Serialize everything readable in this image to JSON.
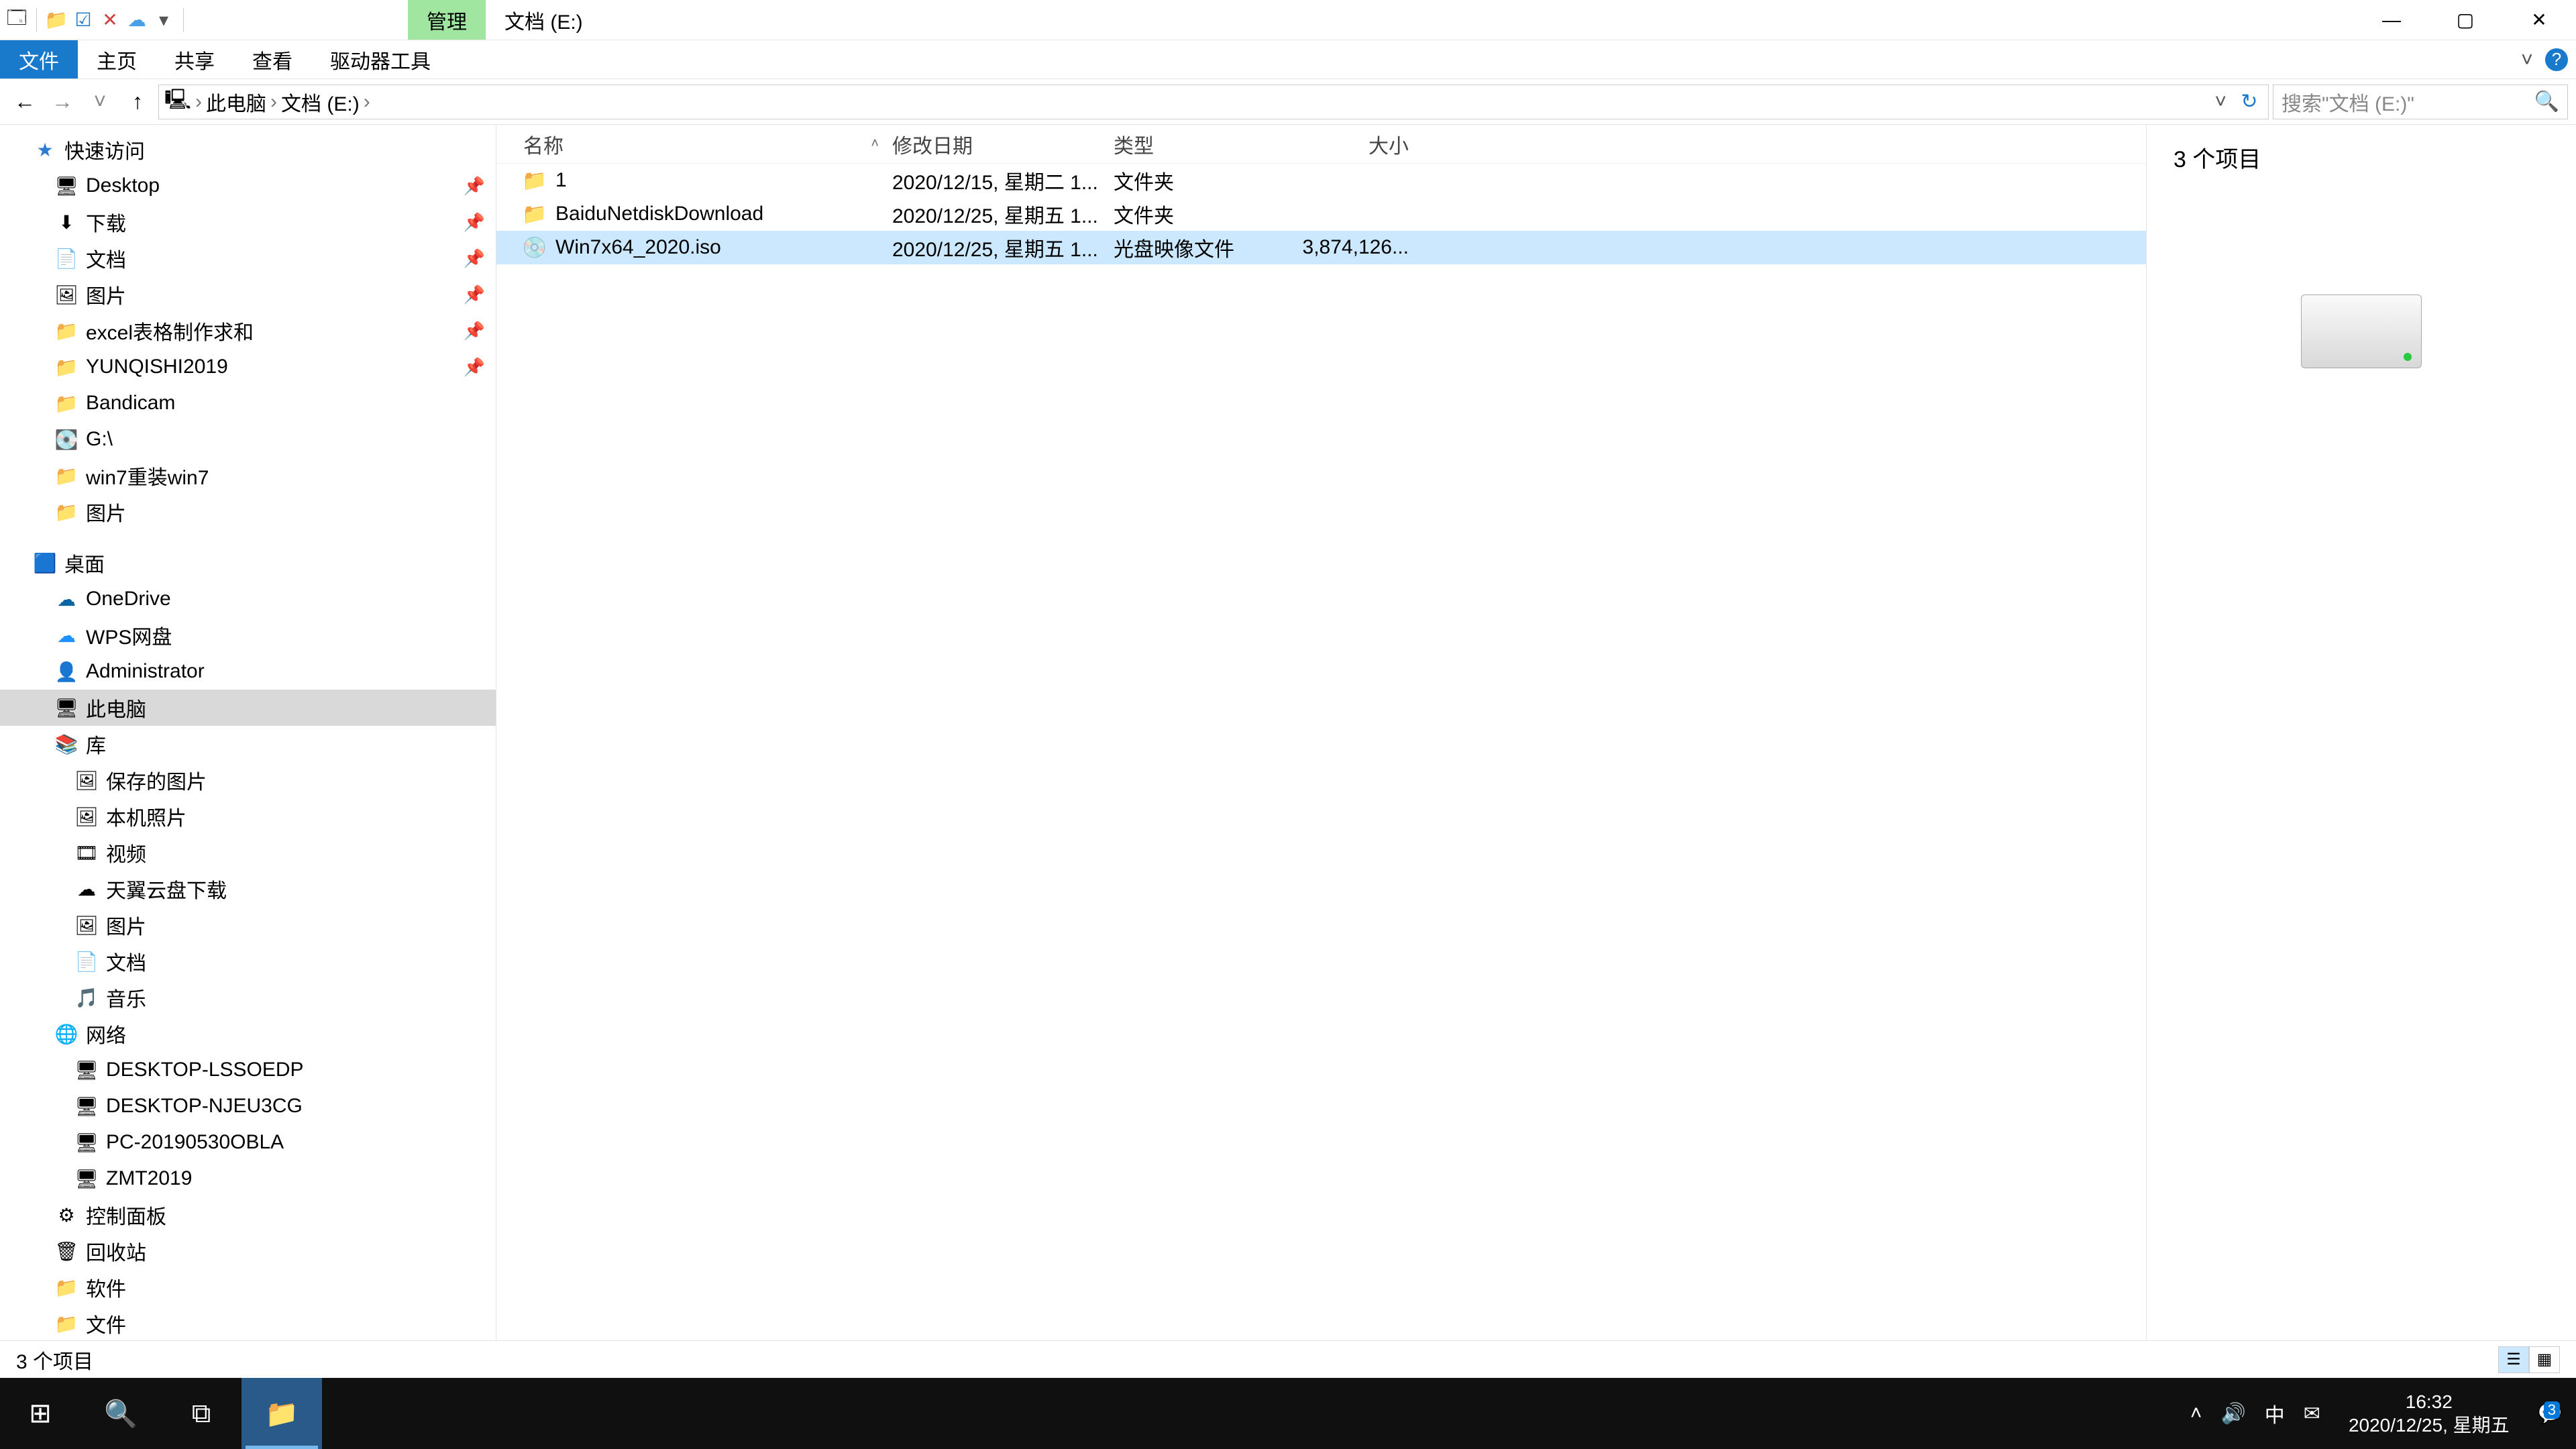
{
  "title": {
    "context_tab": "管理",
    "window_title": "文档 (E:)"
  },
  "window_controls": {
    "min": "—",
    "max": "▢",
    "close": "✕"
  },
  "ribbon": {
    "tabs": [
      "文件",
      "主页",
      "共享",
      "查看",
      "驱动器工具"
    ],
    "expand": "˅",
    "help": "?"
  },
  "nav": {
    "back": "←",
    "forward": "→",
    "recent": "˅",
    "up": "↑"
  },
  "breadcrumb": {
    "root_icon": "🖳",
    "items": [
      "此电脑",
      "文档 (E:)"
    ],
    "sep": "›"
  },
  "address_controls": {
    "dropdown": "˅",
    "refresh": "↻"
  },
  "search": {
    "placeholder": "搜索\"文档 (E:)\"",
    "icon": "🔍"
  },
  "tree": {
    "quick_access": {
      "label": "快速访问",
      "icon": "★"
    },
    "quick_items": [
      {
        "label": "Desktop",
        "icon": "🖥",
        "pinned": true
      },
      {
        "label": "下载",
        "icon": "⬇",
        "pinned": true
      },
      {
        "label": "文档",
        "icon": "📄",
        "pinned": true
      },
      {
        "label": "图片",
        "icon": "🖼",
        "pinned": true
      },
      {
        "label": "excel表格制作求和",
        "icon": "📁",
        "pinned": true
      },
      {
        "label": "YUNQISHI2019",
        "icon": "📁",
        "pinned": true
      },
      {
        "label": "Bandicam",
        "icon": "📁",
        "pinned": false
      },
      {
        "label": "G:\\",
        "icon": "💽",
        "pinned": false
      },
      {
        "label": "win7重装win7",
        "icon": "📁",
        "pinned": false
      },
      {
        "label": "图片",
        "icon": "📁",
        "pinned": false
      }
    ],
    "desktop": {
      "label": "桌面",
      "icon": "🟦"
    },
    "desktop_items": [
      {
        "label": "OneDrive",
        "icon": "☁"
      },
      {
        "label": "WPS网盘",
        "icon": "☁"
      },
      {
        "label": "Administrator",
        "icon": "👤"
      },
      {
        "label": "此电脑",
        "icon": "🖥",
        "selected": true
      },
      {
        "label": "库",
        "icon": "📚"
      }
    ],
    "lib_items": [
      {
        "label": "保存的图片",
        "icon": "🖼"
      },
      {
        "label": "本机照片",
        "icon": "🖼"
      },
      {
        "label": "视频",
        "icon": "🎞"
      },
      {
        "label": "天翼云盘下载",
        "icon": "☁"
      },
      {
        "label": "图片",
        "icon": "🖼"
      },
      {
        "label": "文档",
        "icon": "📄"
      },
      {
        "label": "音乐",
        "icon": "🎵"
      }
    ],
    "network": {
      "label": "网络",
      "icon": "🌐"
    },
    "network_items": [
      {
        "label": "DESKTOP-LSSOEDP",
        "icon": "🖥"
      },
      {
        "label": "DESKTOP-NJEU3CG",
        "icon": "🖥"
      },
      {
        "label": "PC-20190530OBLA",
        "icon": "🖥"
      },
      {
        "label": "ZMT2019",
        "icon": "🖥"
      }
    ],
    "extras": [
      {
        "label": "控制面板",
        "icon": "⚙"
      },
      {
        "label": "回收站",
        "icon": "🗑"
      },
      {
        "label": "软件",
        "icon": "📁"
      },
      {
        "label": "文件",
        "icon": "📁"
      }
    ]
  },
  "columns": {
    "name": "名称",
    "date": "修改日期",
    "type": "类型",
    "size": "大小",
    "sort": "˄"
  },
  "rows": [
    {
      "icon": "📁",
      "name": "1",
      "date": "2020/12/15, 星期二 1...",
      "type": "文件夹",
      "size": ""
    },
    {
      "icon": "📁",
      "name": "BaiduNetdiskDownload",
      "date": "2020/12/25, 星期五 1...",
      "type": "文件夹",
      "size": ""
    },
    {
      "icon": "💿",
      "name": "Win7x64_2020.iso",
      "date": "2020/12/25, 星期五 1...",
      "type": "光盘映像文件",
      "size": "3,874,126...",
      "selected": true
    }
  ],
  "preview": {
    "count_text": "3 个项目"
  },
  "status": {
    "text": "3 个项目"
  },
  "taskbar": {
    "start": "⊞",
    "search": "🔍",
    "taskview": "⧉",
    "explorer": "📁",
    "tray": {
      "up": "˄",
      "volume": "🔊",
      "ime": "中",
      "mail": "✉"
    },
    "time": "16:32",
    "date": "2020/12/25, 星期五",
    "action_center_badge": "3"
  }
}
